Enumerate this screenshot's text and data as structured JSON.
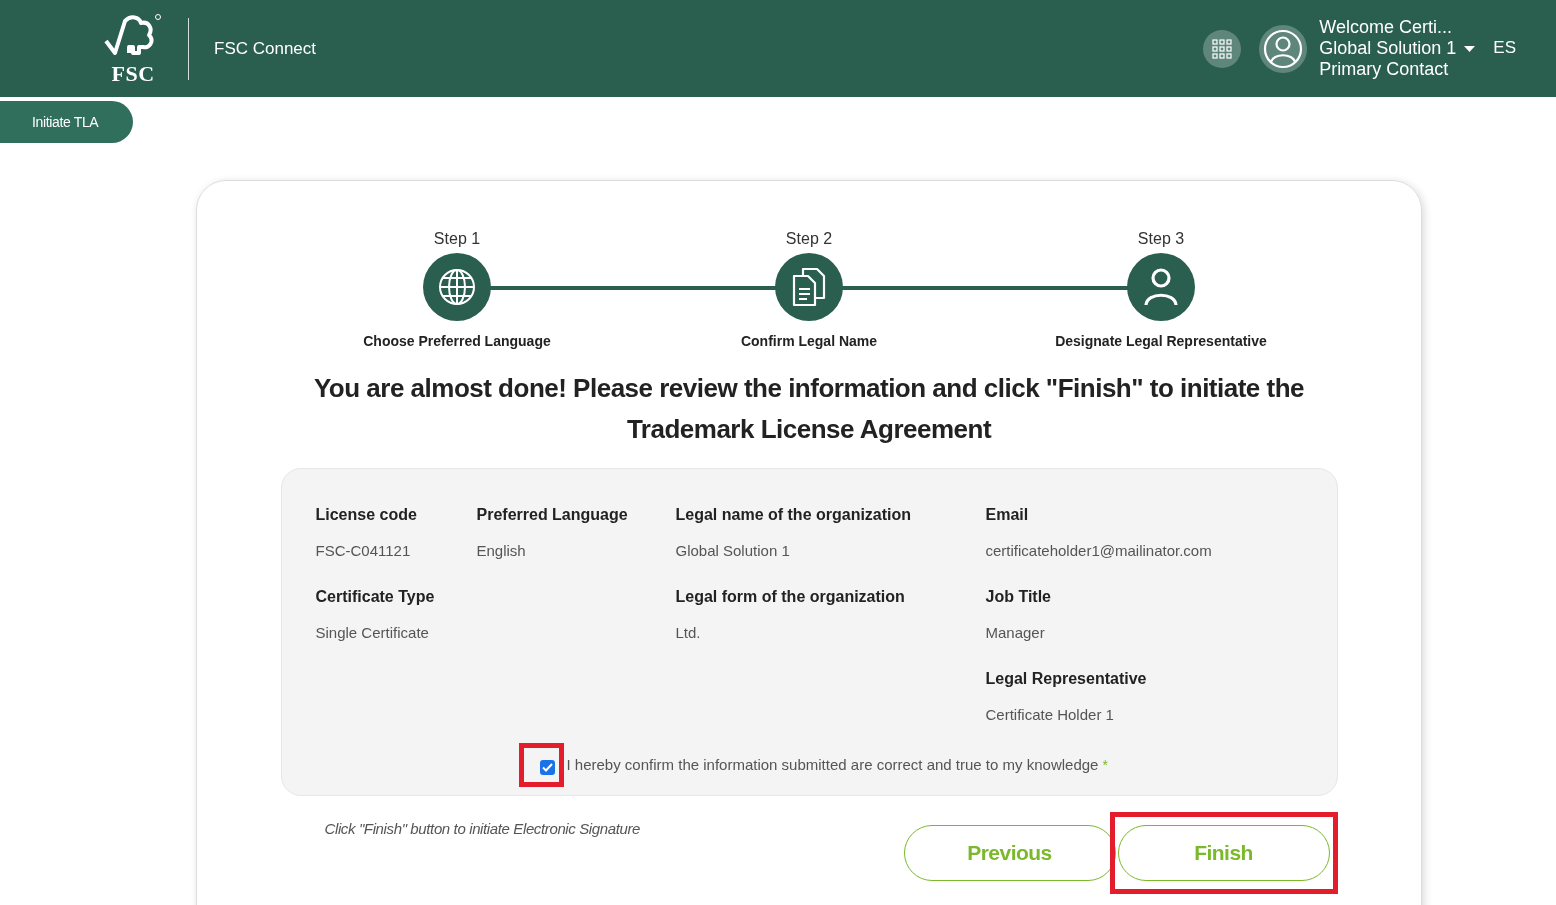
{
  "header": {
    "logo_text": "FSC",
    "app_name": "FSC Connect",
    "user_lines": [
      "Welcome Certi...",
      "Global Solution 1",
      "Primary Contact"
    ],
    "language": "ES"
  },
  "tab": {
    "label": "Initiate TLA",
    "selected": true
  },
  "steps": [
    {
      "step": "Step 1",
      "label": "Choose Preferred Language",
      "kind": "globe"
    },
    {
      "step": "Step 2",
      "label": "Confirm Legal Name",
      "kind": "document"
    },
    {
      "step": "Step 3",
      "label": "Designate Legal Representative",
      "kind": "person"
    }
  ],
  "heading": "You are almost done! Please review the information and click \"Finish\" to initiate the Trademark License Agreement",
  "field_columns": [
    [
      {
        "label": "License code",
        "value": "FSC-C041121"
      },
      {
        "label": "Certificate Type",
        "value": "Single Certificate"
      }
    ],
    [
      {
        "label": "Preferred Language",
        "value": "English"
      }
    ],
    [
      {
        "label": "Legal name of the organization",
        "value": "Global Solution 1"
      },
      {
        "label": "Legal form of the organization",
        "value": "Ltd."
      }
    ],
    [
      {
        "label": "Email",
        "value": "certificateholder1@mailinator.com"
      },
      {
        "label": "Job Title",
        "value": "Manager"
      },
      {
        "label": "Legal Representative",
        "value": "Certificate Holder 1"
      }
    ]
  ],
  "confirmation": {
    "text": "I hereby confirm the information submitted are correct and true to my knowledge",
    "required_mark": "*",
    "checked": true,
    "highlighted": true
  },
  "note": "Click \"Finish\" button to initiate Electronic Signature",
  "buttons": [
    {
      "label": "Previous",
      "highlighted": false
    },
    {
      "label": "Finish",
      "highlighted": true
    }
  ]
}
